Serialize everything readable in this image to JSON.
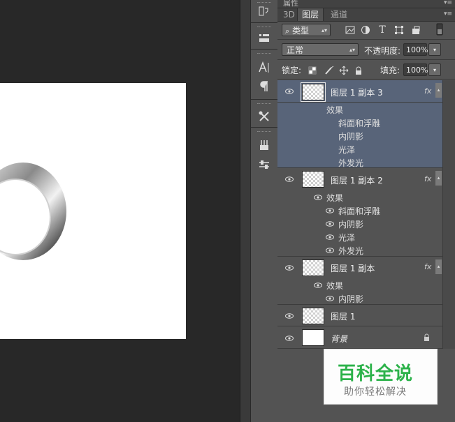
{
  "top_strip": {
    "title": "属性"
  },
  "tabs": [
    {
      "label": "3D",
      "active": false
    },
    {
      "label": "图层",
      "active": true
    },
    {
      "label": "通道",
      "active": false
    }
  ],
  "filter": {
    "kind_label": "类型",
    "icons": [
      "image-filter-icon",
      "adjustment-filter-icon",
      "type-filter-icon",
      "shape-filter-icon",
      "smart-object-filter-icon",
      "filter-toggle-icon"
    ]
  },
  "blend": {
    "mode": "正常",
    "opacity_label": "不透明度:",
    "opacity_value": "100%"
  },
  "lock": {
    "label": "锁定:",
    "fill_label": "填充:",
    "fill_value": "100%"
  },
  "layers": [
    {
      "name": "图层 1 副本 3",
      "selected": true,
      "fx": "fx",
      "effects_label": "效果",
      "effects": [
        "斜面和浮雕",
        "内阴影",
        "光泽",
        "外发光"
      ]
    },
    {
      "name": "图层 1 副本 2",
      "selected": false,
      "fx": "fx",
      "effects_label": "效果",
      "effects": [
        "斜面和浮雕",
        "内阴影",
        "光泽",
        "外发光"
      ]
    },
    {
      "name": "图层 1 副本",
      "selected": false,
      "fx": "fx",
      "effects_label": "效果",
      "effects": [
        "内阴影"
      ]
    },
    {
      "name": "图层 1",
      "selected": false
    },
    {
      "name": "背景",
      "selected": false,
      "locked": true
    }
  ],
  "watermark": {
    "title": "百科全说",
    "subtitle": "助你轻松解决"
  }
}
